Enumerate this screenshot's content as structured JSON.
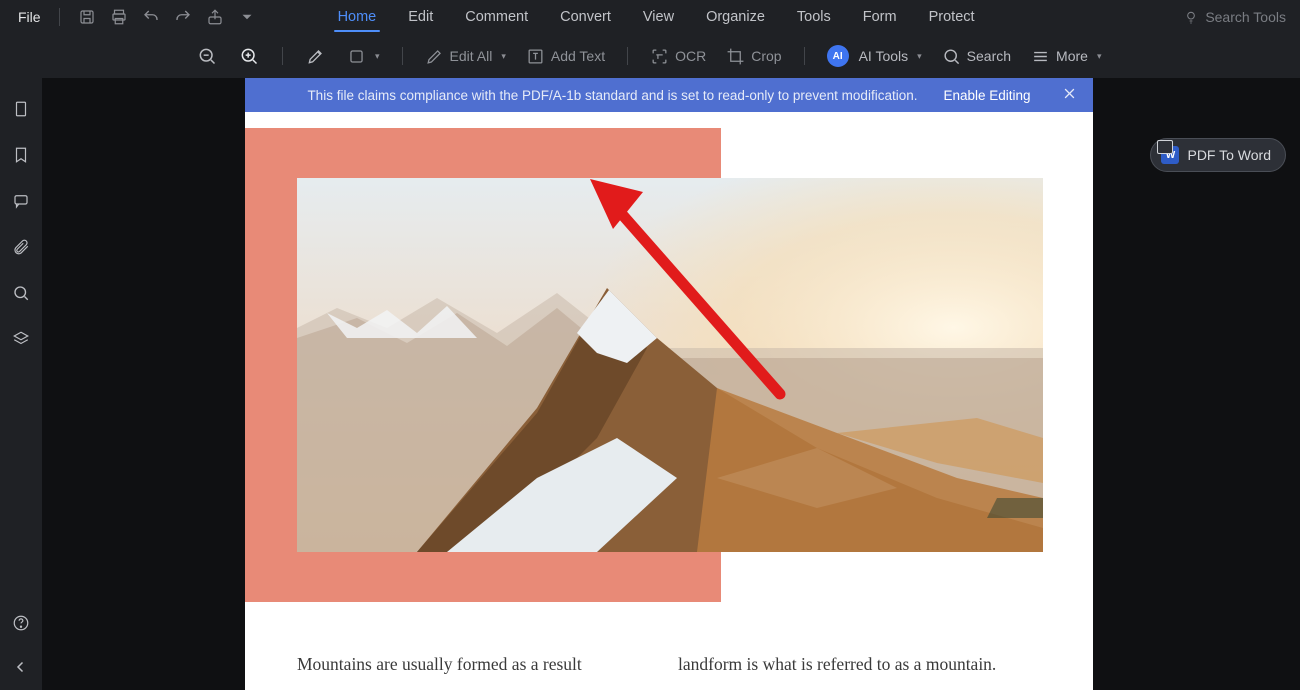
{
  "menu": {
    "file": "File"
  },
  "tabs": {
    "home": "Home",
    "edit": "Edit",
    "comment": "Comment",
    "convert": "Convert",
    "view": "View",
    "organize": "Organize",
    "tools": "Tools",
    "form": "Form",
    "protect": "Protect"
  },
  "search_tools_placeholder": "Search Tools",
  "toolbar": {
    "edit_all": "Edit All",
    "add_text": "Add Text",
    "ocr": "OCR",
    "crop": "Crop",
    "ai_tools": "AI Tools",
    "search": "Search",
    "more": "More"
  },
  "banner": {
    "message": "This file claims compliance with the PDF/A-1b standard and is set to read-only to prevent modification.",
    "action": "Enable Editing"
  },
  "pdf_to_word": "PDF To Word",
  "doc": {
    "col1": "Mountains are usually formed as a result",
    "col2": "landform is what is referred to as a mountain."
  },
  "ai_badge_text": "AI",
  "word_badge_text": "W"
}
